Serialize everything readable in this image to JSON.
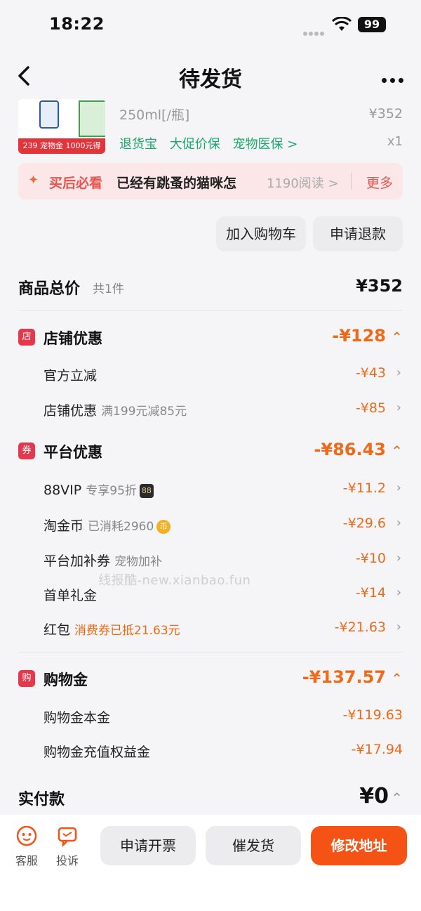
{
  "status_bar": {
    "time": "18:22",
    "battery": "99"
  },
  "nav": {
    "title": "待发货"
  },
  "product": {
    "spec": "250ml[/瓶]",
    "price": "¥352",
    "qty": "x1",
    "tags": [
      "退货宝",
      "大促价保",
      "宠物医保 >"
    ],
    "thumb_banner": "239 宠物金 1000元得1100"
  },
  "promo": {
    "label": "买后必看",
    "text": "已经有跳蚤的猫咪怎",
    "reads": "1190阅读 >",
    "more": "更多"
  },
  "actions": {
    "add_cart": "加入购物车",
    "refund": "申请退款"
  },
  "summary": {
    "total_label": "商品总价",
    "total_count": "共1件",
    "total_value": "¥352",
    "sections": [
      {
        "icon": "店",
        "label": "店铺优惠",
        "value": "-¥128",
        "items": [
          {
            "label": "官方立减",
            "sub": "",
            "value": "-¥43"
          },
          {
            "label": "店铺优惠",
            "sub": "满199元减85元",
            "value": "-¥85"
          }
        ]
      },
      {
        "icon": "券",
        "label": "平台优惠",
        "value": "-¥86.43",
        "items": [
          {
            "label": "88VIP",
            "sub": "专享95折",
            "badge": "88",
            "value": "-¥11.2"
          },
          {
            "label": "淘金币",
            "sub": "已消耗2960",
            "badge": "币",
            "value": "-¥29.6"
          },
          {
            "label": "平台加补券",
            "sub": "宠物加补",
            "value": "-¥10"
          },
          {
            "label": "首单礼金",
            "sub": "",
            "value": "-¥14"
          },
          {
            "label": "红包",
            "sub": "消费券已抵21.63元",
            "value": "-¥21.63"
          }
        ]
      },
      {
        "icon": "购",
        "label": "购物金",
        "value": "-¥137.57",
        "items": [
          {
            "label": "购物金本金",
            "value": "-¥119.63"
          },
          {
            "label": "购物金充值权益金",
            "value": "-¥17.94"
          }
        ]
      }
    ],
    "pay_label": "实付款",
    "pay_value": "¥0"
  },
  "watermark": "线报酷-new.xianbao.fun",
  "bottom": {
    "service": "客服",
    "complain": "投诉",
    "invoice": "申请开票",
    "urge": "催发货",
    "address": "修改地址"
  }
}
